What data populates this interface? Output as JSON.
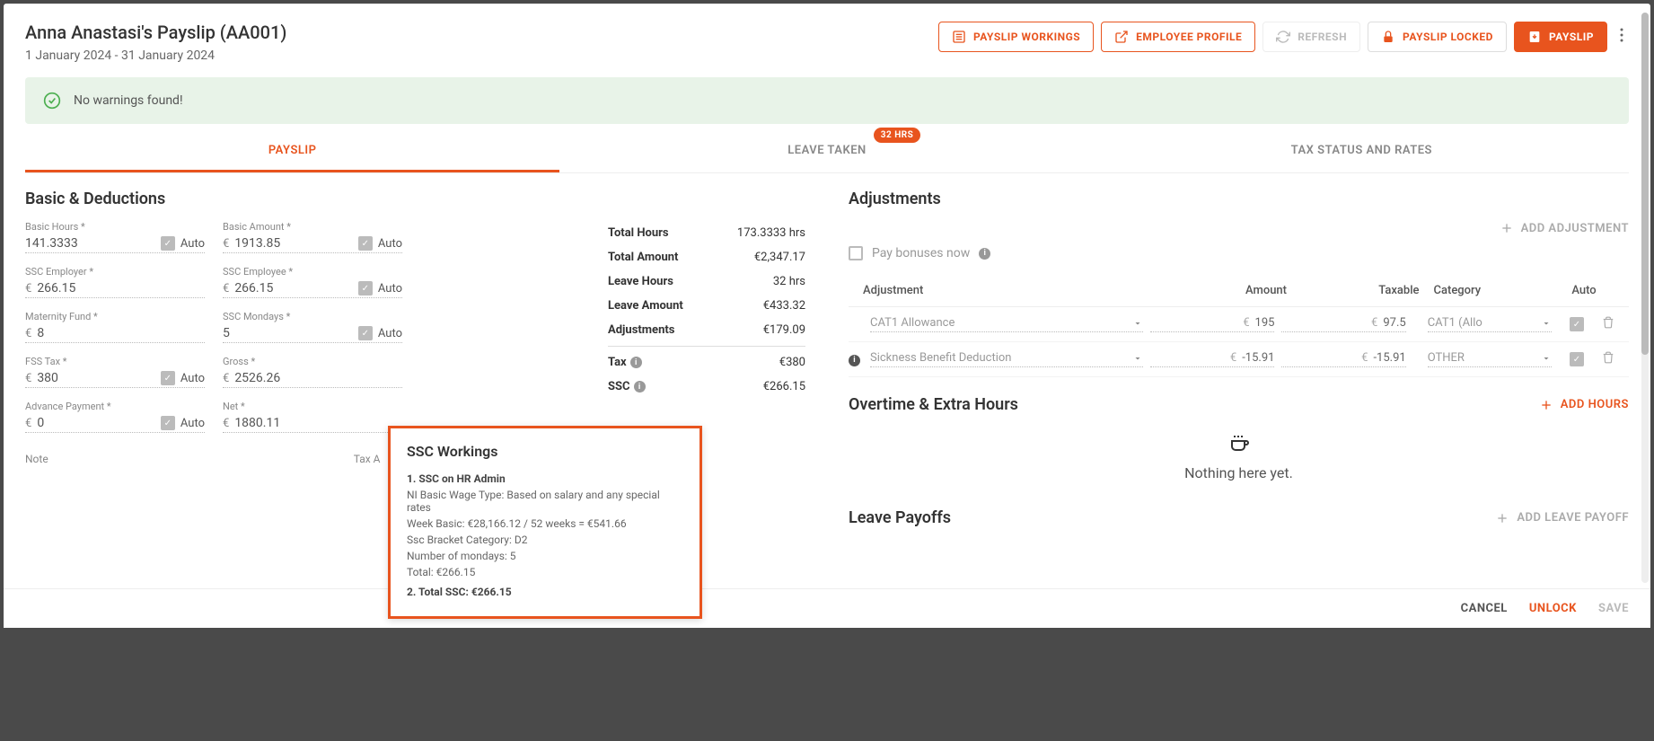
{
  "header": {
    "title": "Anna Anastasi's Payslip (AA001)",
    "date_range": "1 January 2024 - 31 January 2024",
    "btn_workings": "PAYSLIP WORKINGS",
    "btn_profile": "EMPLOYEE PROFILE",
    "btn_refresh": "REFRESH",
    "btn_locked": "PAYSLIP LOCKED",
    "btn_payslip": "PAYSLIP"
  },
  "notice": "No warnings found!",
  "tabs": {
    "payslip": "PAYSLIP",
    "leave": "LEAVE TAKEN",
    "leave_badge": "32 HRS",
    "tax": "TAX STATUS AND RATES"
  },
  "basic": {
    "title": "Basic & Deductions",
    "fields": {
      "basic_hours": {
        "label": "Basic Hours *",
        "value": "141.3333",
        "auto": "Auto"
      },
      "basic_amount": {
        "label": "Basic Amount *",
        "value": "1913.85",
        "auto": "Auto"
      },
      "ssc_employer": {
        "label": "SSC Employer *",
        "value": "266.15"
      },
      "ssc_employee": {
        "label": "SSC Employee *",
        "value": "266.15",
        "auto": "Auto"
      },
      "maternity": {
        "label": "Maternity Fund *",
        "value": "8"
      },
      "ssc_mondays": {
        "label": "SSC Mondays *",
        "value": "5",
        "auto": "Auto"
      },
      "fss_tax": {
        "label": "FSS Tax *",
        "value": "380",
        "auto": "Auto"
      },
      "gross": {
        "label": "Gross *",
        "value": "2526.26"
      },
      "advance": {
        "label": "Advance Payment *",
        "value": "0",
        "auto": "Auto"
      },
      "net": {
        "label": "Net *",
        "value": "1880.11"
      }
    },
    "note_label": "Note",
    "taxa_label": "Tax A"
  },
  "summary": {
    "total_hours": {
      "label": "Total Hours",
      "value": "173.3333 hrs"
    },
    "total_amount": {
      "label": "Total Amount",
      "value": "€2,347.17"
    },
    "leave_hours": {
      "label": "Leave Hours",
      "value": "32 hrs"
    },
    "leave_amount": {
      "label": "Leave Amount",
      "value": "€433.32"
    },
    "adjustments": {
      "label": "Adjustments",
      "value": "€179.09"
    },
    "tax": {
      "label": "Tax",
      "value": "€380"
    },
    "ssc": {
      "label": "SSC",
      "value": "€266.15"
    }
  },
  "popover": {
    "title": "SSC Workings",
    "l1": "1. SSC on HR Admin",
    "l2": "NI Basic Wage Type: Based on salary and any special rates",
    "l3": "Week Basic: €28,166.12 / 52 weeks = €541.66",
    "l4": "Ssc Bracket Category: D2",
    "l5": "Number of mondays: 5",
    "l6": "Total: €266.15",
    "l7": "2. Total SSC: €266.15"
  },
  "adjustments": {
    "title": "Adjustments",
    "add_btn": "ADD ADJUSTMENT",
    "pay_bonus": "Pay bonuses now",
    "cols": {
      "adj": "Adjustment",
      "amt": "Amount",
      "tax": "Taxable",
      "cat": "Category",
      "auto": "Auto"
    },
    "rows": [
      {
        "name": "CAT1 Allowance",
        "amount": "195",
        "taxable": "97.5",
        "category": "CAT1 (Allo"
      },
      {
        "name": "Sickness Benefit Deduction",
        "amount": "-15.91",
        "taxable": "-15.91",
        "category": "OTHER"
      }
    ]
  },
  "overtime": {
    "title": "Overtime & Extra Hours",
    "add_btn": "ADD HOURS",
    "empty": "Nothing here yet."
  },
  "leave_payoffs": {
    "title": "Leave Payoffs",
    "add_btn": "ADD LEAVE PAYOFF"
  },
  "footer": {
    "cancel": "CANCEL",
    "unlock": "UNLOCK",
    "save": "SAVE"
  },
  "currency": "€"
}
